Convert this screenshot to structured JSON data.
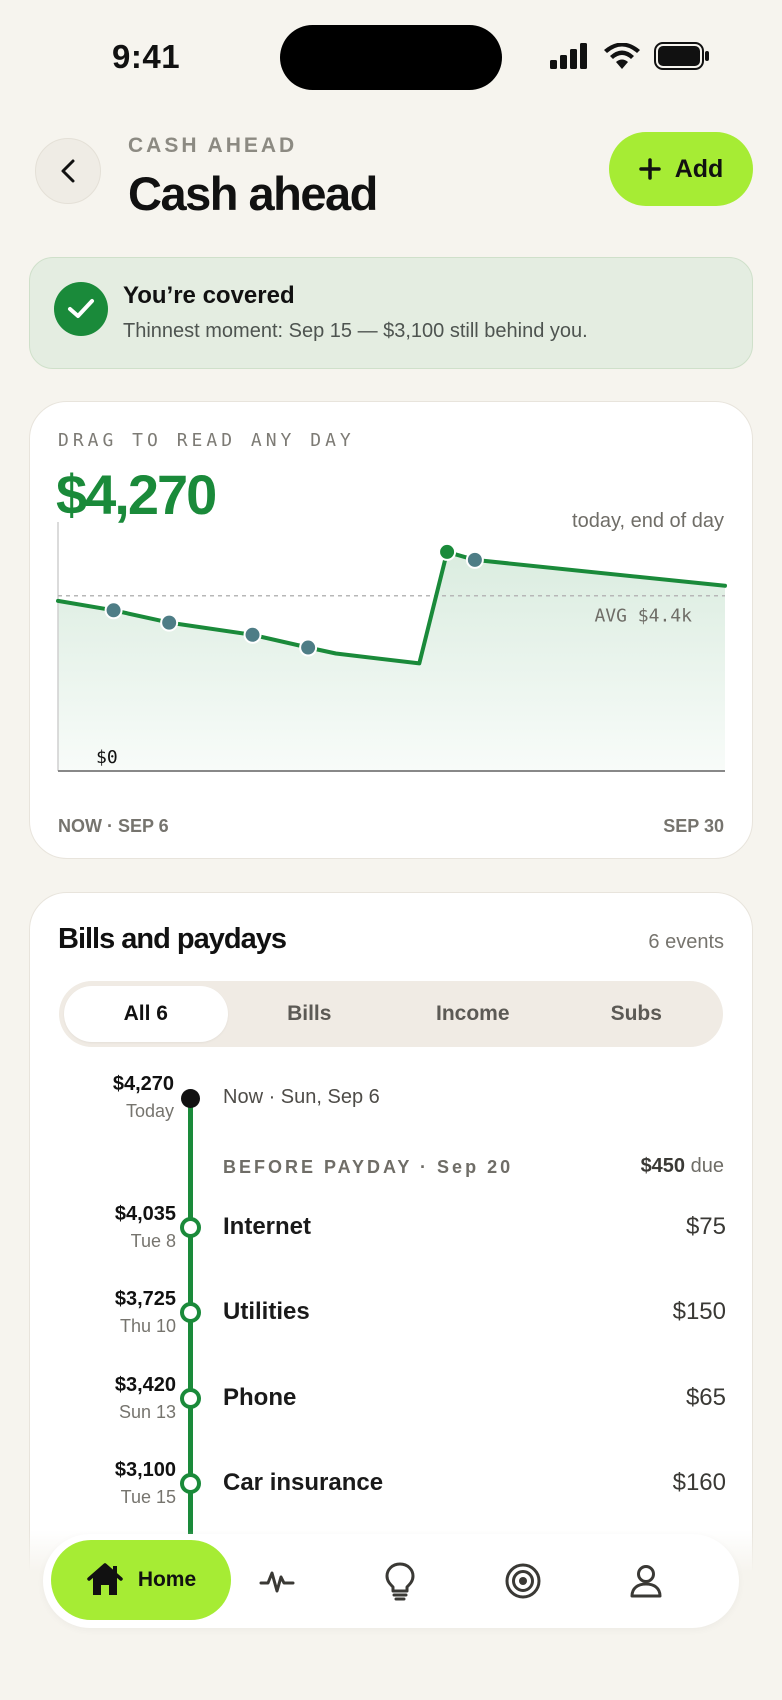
{
  "status": {
    "time": "9:41"
  },
  "header": {
    "eyebrow": "CASH AHEAD",
    "title": "Cash ahead",
    "add_label": "Add"
  },
  "banner": {
    "title": "You’re covered",
    "subtitle": "Thinnest moment: Sep 15 — $3,100 still behind you."
  },
  "chart": {
    "drag_label": "DRAG TO READ ANY DAY",
    "value": "$4,270",
    "caption": "today, end of day",
    "avg_label": "AVG $4.4k",
    "zero_label": "$0",
    "range_start": "NOW · SEP 6",
    "range_end": "SEP 30",
    "colors": {
      "line": "#1a8a3a",
      "marker": "#4e7d86",
      "income": "#1a8a3a"
    }
  },
  "chart_data": {
    "type": "area",
    "x": [
      6,
      8,
      10,
      13,
      15,
      16,
      19,
      20,
      21,
      30
    ],
    "values": [
      4270,
      4035,
      3725,
      3420,
      3100,
      2950,
      2700,
      5500,
      5300,
      4650
    ],
    "markers_x": [
      8,
      10,
      13,
      15
    ],
    "income_x": [
      20
    ],
    "avg": 4400,
    "ylim": [
      0,
      6000
    ],
    "xlabel": "",
    "ylabel": ""
  },
  "bills": {
    "title": "Bills and paydays",
    "count": "6 events",
    "filters": [
      "All 6",
      "Bills",
      "Income",
      "Subs"
    ],
    "now": {
      "amount": "$4,270",
      "sub": "Today",
      "label": "Now · Sun, Sep 6"
    },
    "group": {
      "label": "BEFORE PAYDAY · Sep 20",
      "due_amount": "$450",
      "due_word": "due"
    },
    "events": [
      {
        "amount": "$4,035",
        "date": "Tue 8",
        "name": "Internet",
        "cost": "$75"
      },
      {
        "amount": "$3,725",
        "date": "Thu 10",
        "name": "Utilities",
        "cost": "$150"
      },
      {
        "amount": "$3,420",
        "date": "Sun 13",
        "name": "Phone",
        "cost": "$65"
      },
      {
        "amount": "$3,100",
        "date": "Tue 15",
        "name": "Car insurance",
        "cost": "$160"
      }
    ]
  },
  "nav": {
    "home_label": "Home",
    "icons": [
      "home-icon",
      "activity-icon",
      "lightbulb-icon",
      "target-icon",
      "profile-icon"
    ]
  }
}
